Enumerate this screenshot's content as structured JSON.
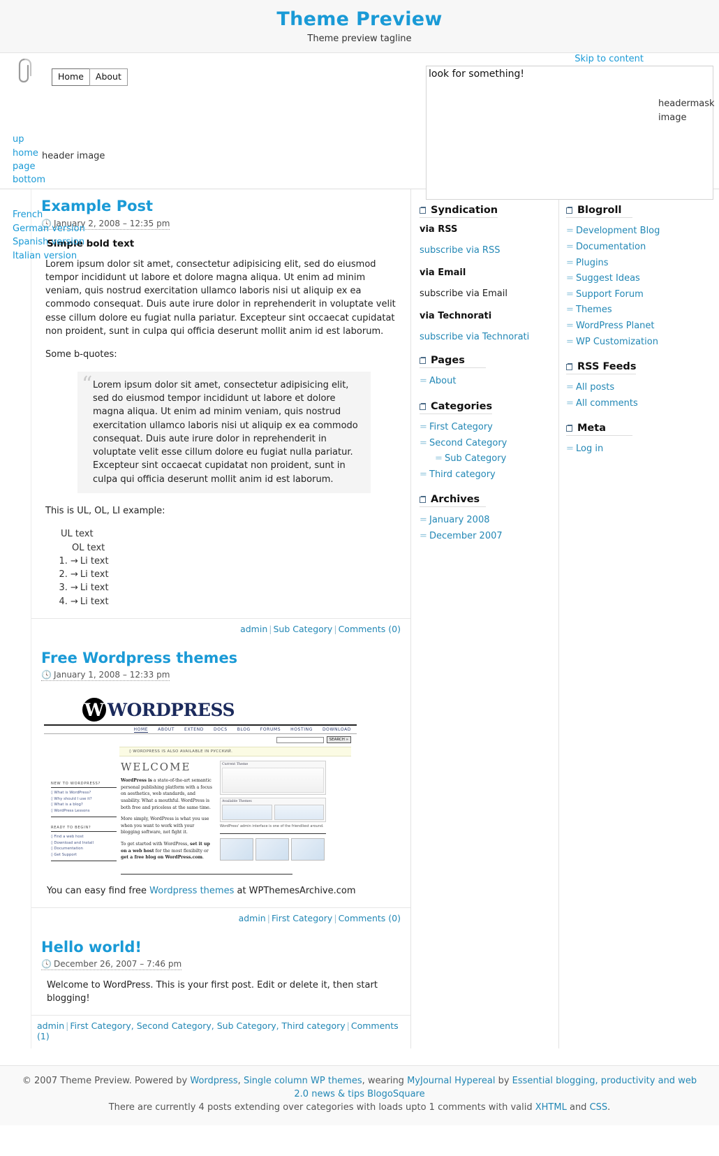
{
  "header": {
    "title": "Theme Preview",
    "tagline": "Theme preview tagline",
    "skip_link": "Skip to content",
    "search_value": "look for something!",
    "search_placeholder": "look for something!",
    "headermask_label": "headermask image",
    "header_image_label": "header image",
    "menu": [
      {
        "label": "Home",
        "current": true
      },
      {
        "label": "About",
        "current": false
      }
    ],
    "access_links": [
      "up",
      "home",
      "page",
      "bottom"
    ],
    "lang_links": [
      "French",
      "German version",
      "Spanish version",
      "Italian version"
    ]
  },
  "posts": [
    {
      "title": "Example Post",
      "date": "January 2, 2008 – 12:35 pm",
      "subhead": "Simple bold text",
      "para1": "Lorem ipsum dolor sit amet, consectetur adipisicing elit, sed do eiusmod tempor incididunt ut labore et dolore magna aliqua. Ut enim ad minim veniam, quis nostrud exercitation ullamco laboris nisi ut aliquip ex ea commodo consequat. Duis aute irure dolor in reprehenderit in voluptate velit esse cillum dolore eu fugiat nulla pariatur. Excepteur sint occaecat cupidatat non proident, sunt in culpa qui officia deserunt mollit anim id est laborum.",
      "quotes_label": "Some b-quotes:",
      "blockquote": "Lorem ipsum dolor sit amet, consectetur adipisicing elit, sed do eiusmod tempor incididunt ut labore et dolore magna aliqua. Ut enim ad minim veniam, quis nostrud exercitation ullamco laboris nisi ut aliquip ex ea commodo consequat. Duis aute irure dolor in reprehenderit in voluptate velit esse cillum dolore eu fugiat nulla pariatur. Excepteur sint occaecat cupidatat non proident, sunt in culpa qui officia deserunt mollit anim id est laborum.",
      "list_label": "This is UL, OL, LI example:",
      "ul_text": "UL text",
      "ol_text": "OL text",
      "li_items": [
        "Li text",
        "Li text",
        "Li text",
        "Li text"
      ],
      "meta": {
        "author": "admin",
        "categories": "Sub Category",
        "comments": "Comments (0)"
      }
    },
    {
      "title": "Free Wordpress themes",
      "date": "January 1, 2008 – 12:33 pm",
      "caption_prefix": "You can easy find free ",
      "caption_link": "Wordpress themes",
      "caption_suffix": " at WPThemesArchive.com",
      "meta": {
        "author": "admin",
        "categories": "First Category",
        "comments": "Comments (0)"
      }
    },
    {
      "title": "Hello world!",
      "date": "December 26, 2007 – 7:46 pm",
      "body": "Welcome to WordPress. This is your first post. Edit or delete it, then start blogging!",
      "meta": {
        "author": "admin",
        "categories": "First Category, Second Category, Sub Category, Third category",
        "comments": "Comments (1)"
      }
    }
  ],
  "wp_screenshot": {
    "brand_letter": "W",
    "brand_word": "WORDPRESS",
    "nav": [
      "HOME",
      "ABOUT",
      "EXTEND",
      "DOCS",
      "BLOG",
      "FORUMS",
      "HOSTING",
      "DOWNLOAD"
    ],
    "search_button": "SEARCH »",
    "notice": "◊ WORDPRESS IS ALSO AVAILABLE IN РУССКИЙ.",
    "left_head_1": "NEW TO WORDPRESS?",
    "left_links_1": [
      "◊ What is WordPress?",
      "◊ Why should I use it?",
      "◊ What is a blog?",
      "◊ WordPress Lessons"
    ],
    "left_head_2": "READY TO BEGIN?",
    "left_links_2": [
      "◊ Find a web host",
      "◊ Download and Install",
      "◊ Documentation",
      "◊ Get Support"
    ],
    "welcome": "WELCOME",
    "p1_bold": "WordPress is",
    "p1": " a state-of-the-art semantic personal publishing platform with a focus on aesthetics, web standards, and usability. What a mouthful. WordPress is both free and priceless at the same time.",
    "p2": "More simply, WordPress is what you use when you want to work with your blogging software, not fight it.",
    "p3_a": "To get started with WordPress, ",
    "p3_b": "set it up on a web host",
    "p3_c": " for the most flexibilty or ",
    "p3_d": "get a free blog on WordPress.com",
    "p3_e": ".",
    "panel_title_1": "Current Theme",
    "panel_title_2": "Available Themes",
    "panel_caption": "WordPress' admin interface is one of the friendliest around."
  },
  "sidebar_mid": {
    "syndication": {
      "title": "Syndication",
      "rows": [
        {
          "type": "strong",
          "text": "via RSS"
        },
        {
          "type": "link",
          "text": "subscribe via RSS"
        },
        {
          "type": "strong",
          "text": "via Email"
        },
        {
          "type": "plain",
          "text": "subscribe via Email"
        },
        {
          "type": "strong",
          "text": "via Technorati"
        },
        {
          "type": "link",
          "text": "subscribe via Technorati"
        }
      ]
    },
    "pages": {
      "title": "Pages",
      "items": [
        {
          "label": "About",
          "sub": false
        }
      ]
    },
    "categories": {
      "title": "Categories",
      "items": [
        {
          "label": "First Category",
          "sub": false
        },
        {
          "label": "Second Category",
          "sub": false
        },
        {
          "label": "Sub Category",
          "sub": true
        },
        {
          "label": "Third category",
          "sub": false
        }
      ]
    },
    "archives": {
      "title": "Archives",
      "items": [
        {
          "label": "January 2008",
          "sub": false
        },
        {
          "label": "December 2007",
          "sub": false
        }
      ]
    }
  },
  "sidebar_right": {
    "blogroll": {
      "title": "Blogroll",
      "items": [
        {
          "label": "Development Blog"
        },
        {
          "label": "Documentation"
        },
        {
          "label": "Plugins"
        },
        {
          "label": "Suggest Ideas"
        },
        {
          "label": "Support Forum"
        },
        {
          "label": "Themes"
        },
        {
          "label": "WordPress Planet"
        },
        {
          "label": "WP Customization"
        }
      ]
    },
    "rss_feeds": {
      "title": "RSS Feeds",
      "items": [
        {
          "label": "All posts"
        },
        {
          "label": "All comments"
        }
      ]
    },
    "meta": {
      "title": "Meta",
      "items": [
        {
          "label": "Log in"
        }
      ]
    }
  },
  "footer": {
    "copyright": "© 2007 Theme Preview. Powered by ",
    "link_wordpress": "Wordpress",
    "sep1": ", ",
    "link_single_column": "Single column WP themes",
    "mid": ", wearing ",
    "link_myjournal": "MyJournal Hypereal",
    "by": " by ",
    "link_essential": "Essential blogging, productivity and web 2.0 news & tips",
    "link_blogosquare": " BlogoSquare",
    "stats_a": "There are currently 4 posts extending over categories with loads upto 1 comments with valid ",
    "link_xhtml": "XHTML",
    "stats_b": " and ",
    "link_css": "CSS",
    "stats_c": "."
  }
}
